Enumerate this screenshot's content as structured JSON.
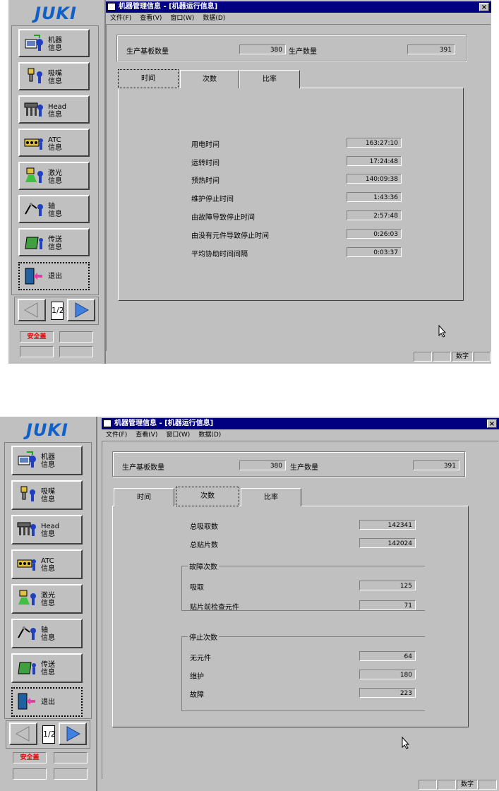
{
  "sidebar": {
    "logo": "JUKI",
    "items": [
      {
        "label1": "机器",
        "label2": "信息",
        "icon": "machine-icon"
      },
      {
        "label1": "吸嘴",
        "label2": "信息",
        "icon": "nozzle-icon"
      },
      {
        "label1": "Head",
        "label2": "信息",
        "icon": "head-icon"
      },
      {
        "label1": "ATC",
        "label2": "信息",
        "icon": "atc-icon"
      },
      {
        "label1": "激光",
        "label2": "信息",
        "icon": "laser-icon"
      },
      {
        "label1": "轴",
        "label2": "信息",
        "icon": "axis-icon"
      },
      {
        "label1": "传送",
        "label2": "信息",
        "icon": "conveyor-icon"
      }
    ],
    "exit_label": "退出",
    "page": "1/2",
    "safety_label": "安全盖"
  },
  "window": {
    "title": "机器管理信息 - [机器运行信息]",
    "close": "×",
    "menu": [
      "文件(F)",
      "查看(V)",
      "窗口(W)",
      "数据(D)"
    ],
    "status_text": "数字"
  },
  "header": {
    "board_count_label": "生产基板数量",
    "board_count_value": "380",
    "prod_count_label": "生产数量",
    "prod_count_value": "391"
  },
  "tabs": [
    "时间",
    "次数",
    "比率"
  ],
  "time_panel": {
    "rows": [
      {
        "label": "用电时间",
        "value": "163:27:10"
      },
      {
        "label": "运转时间",
        "value": "17:24:48"
      },
      {
        "label": "预热时间",
        "value": "140:09:38"
      },
      {
        "label": "维护停止时间",
        "value": "1:43:36"
      },
      {
        "label": "由故障导致停止时间",
        "value": "2:57:48"
      },
      {
        "label": "由没有元件导致停止时间",
        "value": "0:26:03"
      },
      {
        "label": "平均协助时间间隔",
        "value": "0:03:37"
      }
    ]
  },
  "count_panel": {
    "total_pick_label": "总吸取数",
    "total_pick_value": "142341",
    "total_place_label": "总贴片数",
    "total_place_value": "142024",
    "error_group_title": "故障次数",
    "error_rows": [
      {
        "label": "吸取",
        "value": "125"
      },
      {
        "label": "贴片前检查元件",
        "value": "71"
      }
    ],
    "stop_group_title": "停止次数",
    "stop_rows": [
      {
        "label": "无元件",
        "value": "64"
      },
      {
        "label": "维护",
        "value": "180"
      },
      {
        "label": "故障",
        "value": "223"
      }
    ]
  }
}
